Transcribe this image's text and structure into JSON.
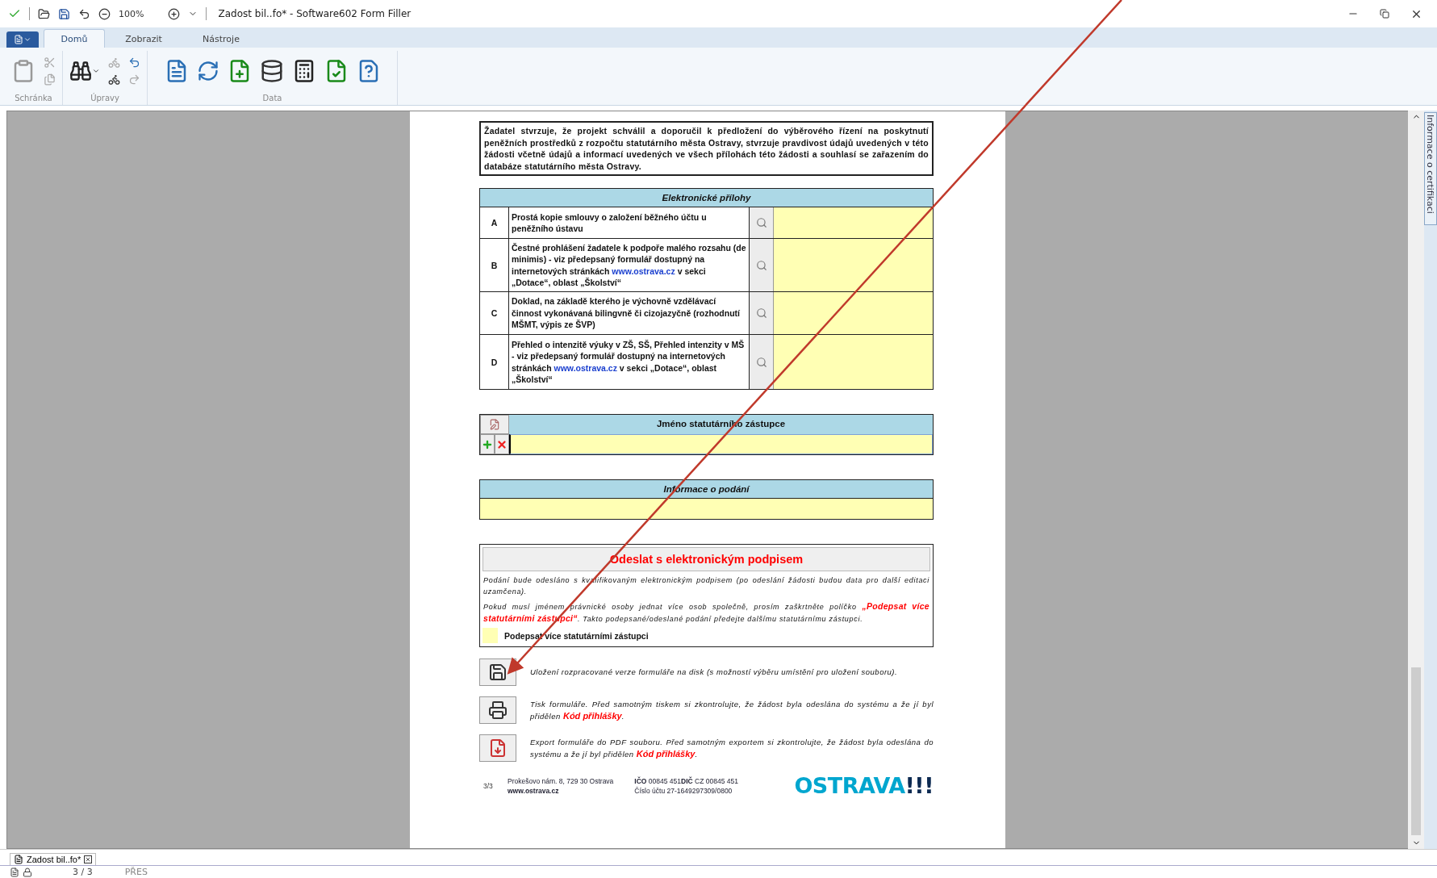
{
  "title_bar": {
    "zoom": "100%",
    "title": "Zadost bil..fo* - Software602 Form Filler"
  },
  "ribbon": {
    "tabs": [
      {
        "label": "Domů",
        "selected": true
      },
      {
        "label": "Zobrazit",
        "selected": false
      },
      {
        "label": "Nástroje",
        "selected": false
      }
    ],
    "groups": [
      {
        "kind": "clipboard",
        "label": "Schránka"
      },
      {
        "kind": "edit",
        "label": "Úpravy"
      },
      {
        "kind": "data",
        "label": "Data"
      }
    ]
  },
  "side_panel": {
    "label": "Informace o certifikaci"
  },
  "document": {
    "declaration": "Žadatel stvrzuje, že projekt schválil a doporučil k předložení do výběrového řízení na poskytnutí peněžních prostředků z rozpočtu statutárního města Ostravy, stvrzuje pravdivost údajů uvedených v této žádosti včetně údajů a informací uvedených ve všech přílohách této žádosti a souhlasí se zařazením do databáze statutárního města Ostravy.",
    "attachments": {
      "title": "Elektronické přílohy",
      "rows": [
        {
          "letter": "A",
          "text": "Prostá kopie smlouvy o založení běžného účtu u peněžního ústavu"
        },
        {
          "letter": "B",
          "text": "Čestné prohlášení žadatele k podpoře malého rozsahu (de minimis) - viz předepsaný formulář dostupný na internetových stránkách",
          "link": "www.ostrava.cz",
          "text_after": "v sekci „Dotace“, oblast „Školství“"
        },
        {
          "letter": "C",
          "text": "Doklad, na základě kterého je výchovně vzdělávací činnost vykonávaná bilingvně či cizojazyčně (rozhodnutí MŠMT, výpis ze ŠVP)"
        },
        {
          "letter": "D",
          "text": "Přehled o intenzitě výuky v ZŠ, SŠ, Přehled intenzity v MŠ - viz předepsaný formulář dostupný na internetových stránkách",
          "link": "www.ostrava.cz",
          "text_after": "v sekci „Dotace“, oblast „Školství“"
        }
      ]
    },
    "representative": {
      "title": "Jméno statutárního zástupce",
      "focused": true
    },
    "submission": {
      "title": "Informace o podání"
    },
    "signature": {
      "title": "Odeslat s elektronickým podpisem",
      "paragraphs": [
        "Podání bude odesláno s kvalifikovaným elektronickým podpisem (po odeslání žádosti budou data pro další editaci uzamčena).",
        "Pokud musí jménem právnické osoby jednat více osob společně, prosím zaškrtněte políčko **„Podepsat více statutárními zástupci“**. Takto podepsané/odeslané podání předejte dalšímu statutárnímu zástupci."
      ],
      "checkbox": {
        "label": "Podepsat více statutárními zástupci",
        "checked": false
      }
    },
    "actions": [
      {
        "kind": "save",
        "text": "Uložení rozpracované verze formuláře na disk (s možností výběru umístění pro uložení souboru)."
      },
      {
        "kind": "print",
        "text": "Tisk formuláře. Před samotným tiskem si zkontrolujte, že žádost byla odeslána do systému a že jí byl přidělen **Kód přihlášky**."
      },
      {
        "kind": "export",
        "text": "Export formuláře do PDF souboru. Před samotným exportem si zkontrolujte, že žádost byla odeslána do systému a že jí byl přidělen **Kód přihlášky**."
      }
    ],
    "footer": {
      "page": "3/3",
      "address": "Prokešovo nám. 8, 729 30 Ostrava",
      "web": "www.ostrava.cz",
      "ids": "**IČO** 00845 451**DIČ** CZ 00845 451",
      "account": "Číslo účtu 27-1649297309/0800",
      "logo_word": "OSTRAVA",
      "logo_marks": "!!!"
    }
  },
  "doc_tab": {
    "label": "Zadost bil..fo*"
  },
  "status_bar": {
    "pages": "3 / 3",
    "mode": "PŘES"
  }
}
